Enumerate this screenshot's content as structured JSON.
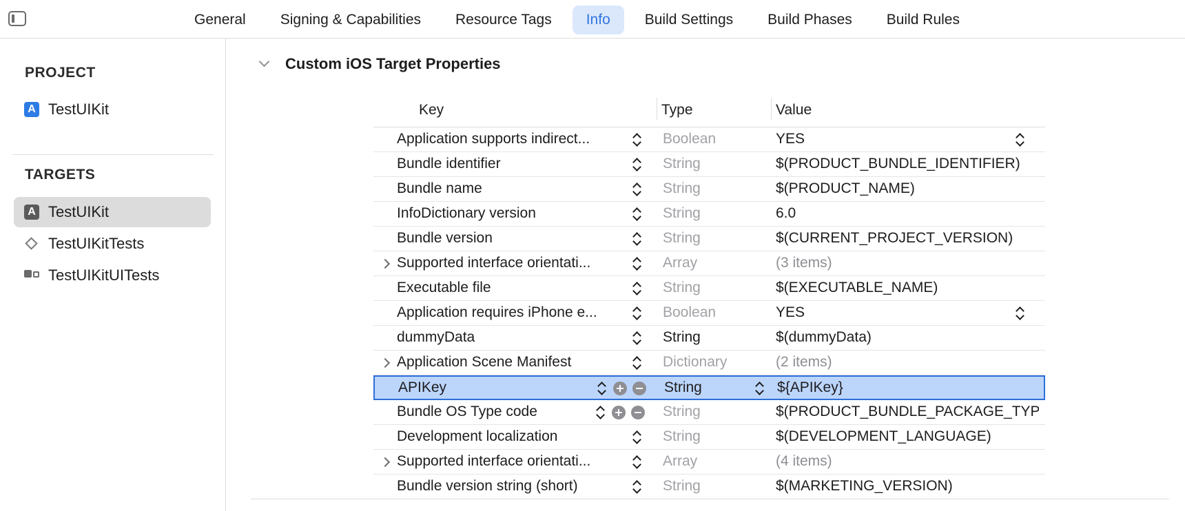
{
  "tabs": [
    {
      "label": "General"
    },
    {
      "label": "Signing & Capabilities"
    },
    {
      "label": "Resource Tags"
    },
    {
      "label": "Info"
    },
    {
      "label": "Build Settings"
    },
    {
      "label": "Build Phases"
    },
    {
      "label": "Build Rules"
    }
  ],
  "active_tab": "Info",
  "sidebar": {
    "project_header": "PROJECT",
    "project_item": "TestUIKit",
    "targets_header": "TARGETS",
    "targets": [
      {
        "label": "TestUIKit",
        "icon": "app-target-icon"
      },
      {
        "label": "TestUIKitTests",
        "icon": "unit-test-target-icon"
      },
      {
        "label": "TestUIKitUITests",
        "icon": "ui-test-target-icon"
      }
    ]
  },
  "section": {
    "title": "Custom iOS Target Properties"
  },
  "table": {
    "headers": {
      "key": "Key",
      "type": "Type",
      "value": "Value"
    },
    "rows": [
      {
        "key": "Application supports indirect...",
        "type": "Boolean",
        "value": "YES"
      },
      {
        "key": "Bundle identifier",
        "type": "String",
        "value": "$(PRODUCT_BUNDLE_IDENTIFIER)"
      },
      {
        "key": "Bundle name",
        "type": "String",
        "value": "$(PRODUCT_NAME)"
      },
      {
        "key": "InfoDictionary version",
        "type": "String",
        "value": "6.0"
      },
      {
        "key": "Bundle version",
        "type": "String",
        "value": "$(CURRENT_PROJECT_VERSION)"
      },
      {
        "key": "Supported interface orientati...",
        "type": "Array",
        "value": "(3 items)"
      },
      {
        "key": "Executable file",
        "type": "String",
        "value": "$(EXECUTABLE_NAME)"
      },
      {
        "key": "Application requires iPhone e...",
        "type": "Boolean",
        "value": "YES"
      },
      {
        "key": "dummyData",
        "type": "String",
        "value": "$(dummyData)"
      },
      {
        "key": "Application Scene Manifest",
        "type": "Dictionary",
        "value": "(2 items)"
      },
      {
        "key": "APIKey",
        "type": "String",
        "value": "${APIKey}"
      },
      {
        "key": "Bundle OS Type code",
        "type": "String",
        "value": "$(PRODUCT_BUNDLE_PACKAGE_TYPE)"
      },
      {
        "key": "Development localization",
        "type": "String",
        "value": "$(DEVELOPMENT_LANGUAGE)"
      },
      {
        "key": "Supported interface orientati...",
        "type": "Array",
        "value": "(4 items)"
      },
      {
        "key": "Bundle version string (short)",
        "type": "String",
        "value": "$(MARKETING_VERSION)"
      }
    ]
  },
  "colors": {
    "accent": "#2f76e0",
    "selection": "#bcd5fb",
    "selection_border": "#2c6fd8"
  }
}
